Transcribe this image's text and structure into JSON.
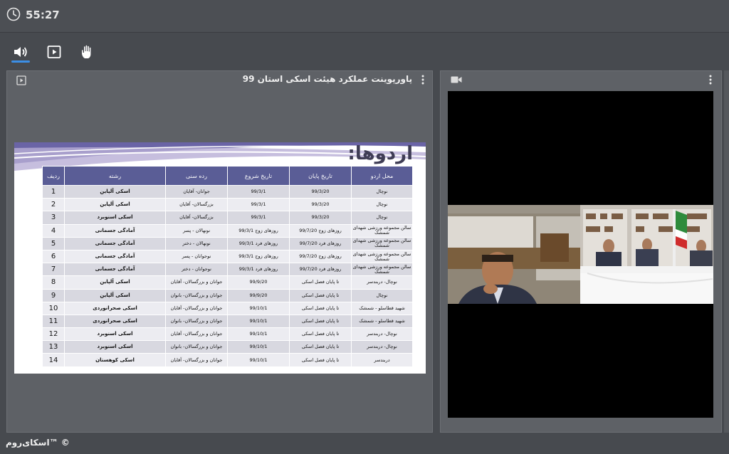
{
  "header": {
    "timer": "55:27"
  },
  "toolbar": {
    "buttons": [
      {
        "name": "speaker",
        "active": true
      },
      {
        "name": "media"
      },
      {
        "name": "raise-hand"
      }
    ],
    "accent": "#3c8fe6"
  },
  "presentation": {
    "title": "پاورپوینت عملکرد هیئت اسکی استان 99",
    "slide": {
      "heading": "اردوها:",
      "columns": [
        "ردیف",
        "رشته",
        "رده سنی",
        "تاریخ شروع",
        "تاریخ پایان",
        "محل اردو"
      ],
      "rows": [
        {
          "n": "1",
          "discipline": "اسکی آلپاین",
          "age": "جوانان- آقایان",
          "start": "99/3/1",
          "end": "99/3/20",
          "place": "نوچال"
        },
        {
          "n": "2",
          "discipline": "اسکی آلپاین",
          "age": "بزرگسالان- آقایان",
          "start": "99/3/1",
          "end": "99/3/20",
          "place": "نوچال"
        },
        {
          "n": "3",
          "discipline": "اسکی اسنوبرد",
          "age": "بزرگسالان- آقایان",
          "start": "99/3/1",
          "end": "99/3/20",
          "place": "نوچال"
        },
        {
          "n": "4",
          "discipline": "آمادگی جسمانی",
          "age": "نونهالان - پسر",
          "start": "روزهای زوج 99/3/1",
          "end": "روزهای زوج 99/7/20",
          "place": "سالن مجموعه ورزشی شهدای شمشک"
        },
        {
          "n": "5",
          "discipline": "آمادگی جسمانی",
          "age": "نونهالان - دختر",
          "start": "روزهای فرد 99/3/1",
          "end": "روزهای فرد 99/7/20",
          "place": "سالن مجموعه ورزشی شهدای شمشک"
        },
        {
          "n": "6",
          "discipline": "آمادگی جسمانی",
          "age": "نوجوانان - پسر",
          "start": "روزهای زوج 99/3/1",
          "end": "روزهای زوج 99/7/20",
          "place": "سالن مجموعه ورزشی شهدای شمشک"
        },
        {
          "n": "7",
          "discipline": "آمادگی جسمانی",
          "age": "نوجوانان - دختر",
          "start": "روزهای فرد 99/3/1",
          "end": "روزهای فرد 99/7/20",
          "place": "سالن مجموعه ورزشی شهدای شمشک"
        },
        {
          "n": "8",
          "discipline": "اسکی آلپاین",
          "age": "جوانان و بزرگسالان- آقایان",
          "start": "99/9/20",
          "end": "تا پایان فصل اسکی",
          "place": "نوچال- دربندسر"
        },
        {
          "n": "9",
          "discipline": "اسکی آلپاین",
          "age": "جوانان و بزرگسالان- بانوان",
          "start": "99/9/20",
          "end": "تا پایان فصل اسکی",
          "place": "نوچال"
        },
        {
          "n": "10",
          "discipline": "اسکی صحرانوردی",
          "age": "جوانان و بزرگسالان- آقایان",
          "start": "99/10/1",
          "end": "تا پایان فصل اسکی",
          "place": "شهید قطاسلو - شمشک"
        },
        {
          "n": "11",
          "discipline": "اسکی صحرانوردی",
          "age": "جوانان و بزرگسالان- بانوان",
          "start": "99/10/1",
          "end": "تا پایان فصل اسکی",
          "place": "شهید قطاسلو - شمشک"
        },
        {
          "n": "12",
          "discipline": "اسکی اسنوبرد",
          "age": "جوانان و بزرگسالان- آقایان",
          "start": "99/10/1",
          "end": "تا پایان فصل اسکی",
          "place": "نوچال- دربندسر"
        },
        {
          "n": "13",
          "discipline": "اسکی اسنوبرد",
          "age": "جوانان و بزرگسالان- بانوان",
          "start": "99/10/1",
          "end": "تا پایان فصل اسکی",
          "place": "نوچال- دربندسر"
        },
        {
          "n": "14",
          "discipline": "اسکی کوهستان",
          "age": "جوانان و بزرگسالان- آقایان",
          "start": "99/10/1",
          "end": "تا پایان فصل اسکی",
          "place": "دربندسر"
        }
      ]
    }
  },
  "video": {
    "icon": "camera-icon"
  },
  "footer": {
    "brand": "اسکای‌روم™ ©"
  }
}
